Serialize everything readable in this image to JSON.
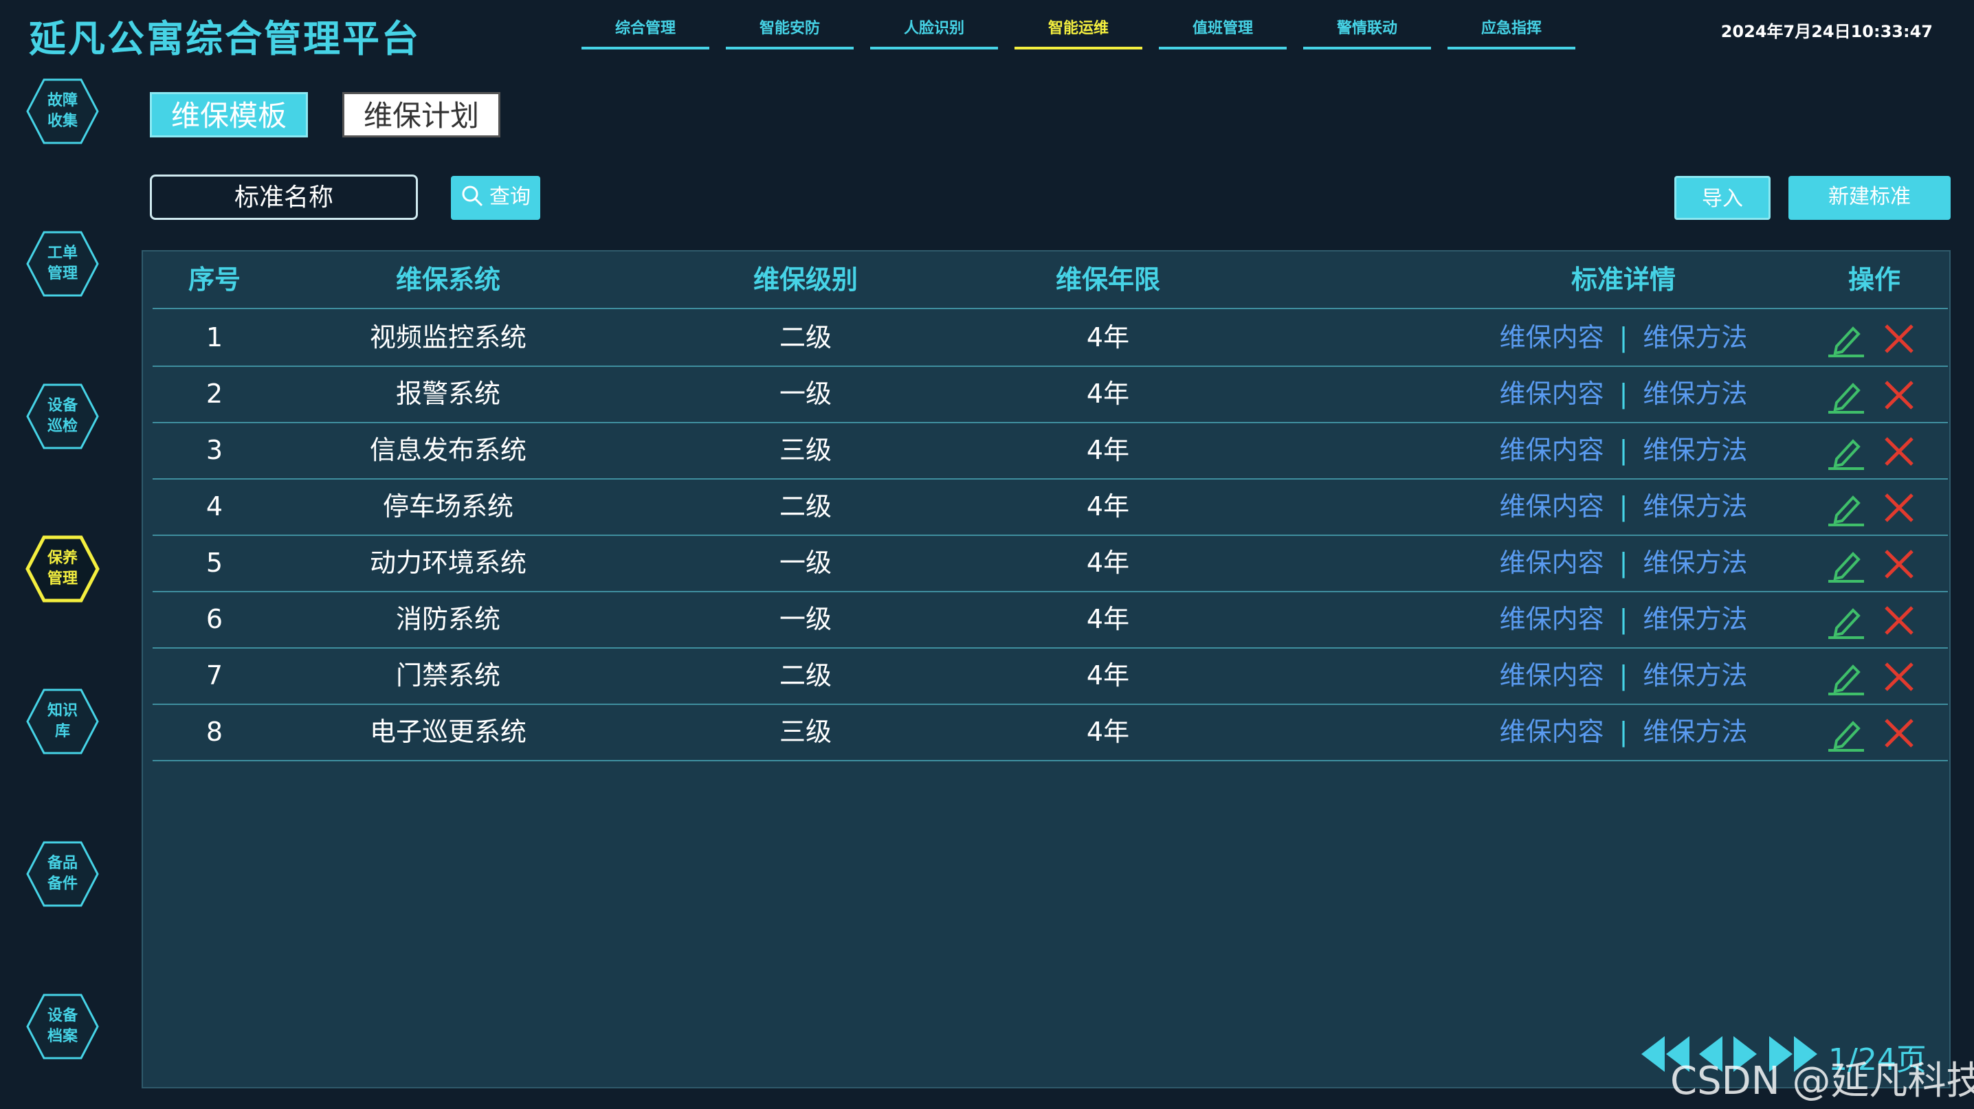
{
  "header": {
    "title": "延凡公寓综合管理平台",
    "datetime": "2024年7月24日10:33:47"
  },
  "nav": {
    "items": [
      {
        "label": "综合管理"
      },
      {
        "label": "智能安防"
      },
      {
        "label": "人脸识别"
      },
      {
        "label": "智能运维",
        "active": true
      },
      {
        "label": "值班管理"
      },
      {
        "label": "警情联动"
      },
      {
        "label": "应急指挥"
      }
    ]
  },
  "sidebar": {
    "items": [
      {
        "line1": "故障",
        "line2": "收集"
      },
      {
        "line1": "工单",
        "line2": "管理"
      },
      {
        "line1": "设备",
        "line2": "巡检"
      },
      {
        "line1": "保养",
        "line2": "管理",
        "active": true
      },
      {
        "line1": "知识",
        "line2": "库"
      },
      {
        "line1": "备品",
        "line2": "备件"
      },
      {
        "line1": "设备",
        "line2": "档案"
      }
    ]
  },
  "tabs": {
    "active": "维保模板",
    "other": "维保计划"
  },
  "toolbar": {
    "search_placeholder": "标准名称",
    "query_label": "查询",
    "import_label": "导入",
    "new_label": "新建标准"
  },
  "table": {
    "headers": {
      "no": "序号",
      "system": "维保系统",
      "level": "维保级别",
      "years": "维保年限",
      "detail": "标准详情",
      "op": "操作"
    },
    "rows": [
      {
        "no": "1",
        "system": "视频监控系统",
        "level": "二级",
        "years": "4年",
        "content": "维保内容",
        "method": "维保方法"
      },
      {
        "no": "2",
        "system": "报警系统",
        "level": "一级",
        "years": "4年",
        "content": "维保内容",
        "method": "维保方法"
      },
      {
        "no": "3",
        "system": "信息发布系统",
        "level": "三级",
        "years": "4年",
        "content": "维保内容",
        "method": "维保方法"
      },
      {
        "no": "4",
        "system": "停车场系统",
        "level": "二级",
        "years": "4年",
        "content": "维保内容",
        "method": "维保方法"
      },
      {
        "no": "5",
        "system": "动力环境系统",
        "level": "一级",
        "years": "4年",
        "content": "维保内容",
        "method": "维保方法"
      },
      {
        "no": "6",
        "system": "消防系统",
        "level": "一级",
        "years": "4年",
        "content": "维保内容",
        "method": "维保方法"
      },
      {
        "no": "7",
        "system": "门禁系统",
        "level": "二级",
        "years": "4年",
        "content": "维保内容",
        "method": "维保方法"
      },
      {
        "no": "8",
        "system": "电子巡更系统",
        "level": "三级",
        "years": "4年",
        "content": "维保内容",
        "method": "维保方法"
      }
    ],
    "separator": "|"
  },
  "pager": {
    "text": "1/24页"
  },
  "watermark": "CSDN @延凡科技",
  "colors": {
    "accent": "#46d3e6",
    "active": "#f4ef3f",
    "link": "#5a9bf0",
    "edit": "#3fbf6a",
    "delete": "#e23a2e"
  },
  "icons": [
    "search-icon",
    "edit-icon",
    "delete-icon",
    "first-page-icon",
    "prev-page-icon",
    "next-page-icon",
    "last-page-icon"
  ]
}
